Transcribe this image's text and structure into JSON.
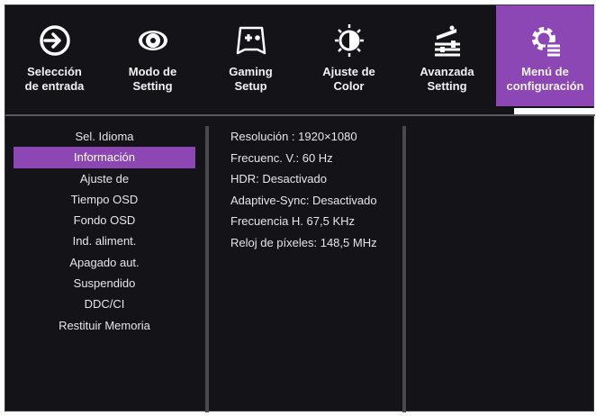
{
  "tabs": [
    {
      "label": "Selección\nde entrada",
      "icon": "input-select-icon",
      "active": false
    },
    {
      "label": "Modo de\nSetting",
      "icon": "eye-icon",
      "active": false
    },
    {
      "label": "Gaming\nSetup",
      "icon": "gamepad-icon",
      "active": false
    },
    {
      "label": "Ajuste de\nColor",
      "icon": "color-bulb-icon",
      "active": false
    },
    {
      "label": "Avanzada\nSetting",
      "icon": "advanced-settings-icon",
      "active": false
    },
    {
      "label": "Menú de\nconfiguración",
      "icon": "gear-menu-icon",
      "active": true
    }
  ],
  "menu": {
    "items": [
      "Sel. Idioma",
      "Información",
      "Ajuste de",
      "Tiempo OSD",
      "Fondo OSD",
      "Ind. aliment.",
      "Apagado aut.",
      "Suspendido",
      "DDC/CI",
      "Restituir Memoria"
    ],
    "selected_index": 1
  },
  "info": {
    "lines": [
      "Resolución : 1920×1080",
      "Frecuenc. V.: 60 Hz",
      "HDR: Desactivado",
      "Adaptive-Sync: Desactivado",
      "Frecuencia H. 67,5 KHz",
      "Reloj de píxeles: 148,5 MHz"
    ]
  },
  "colors": {
    "accent": "#8d47b4",
    "background": "#141418",
    "text": "#e6e6e6"
  }
}
